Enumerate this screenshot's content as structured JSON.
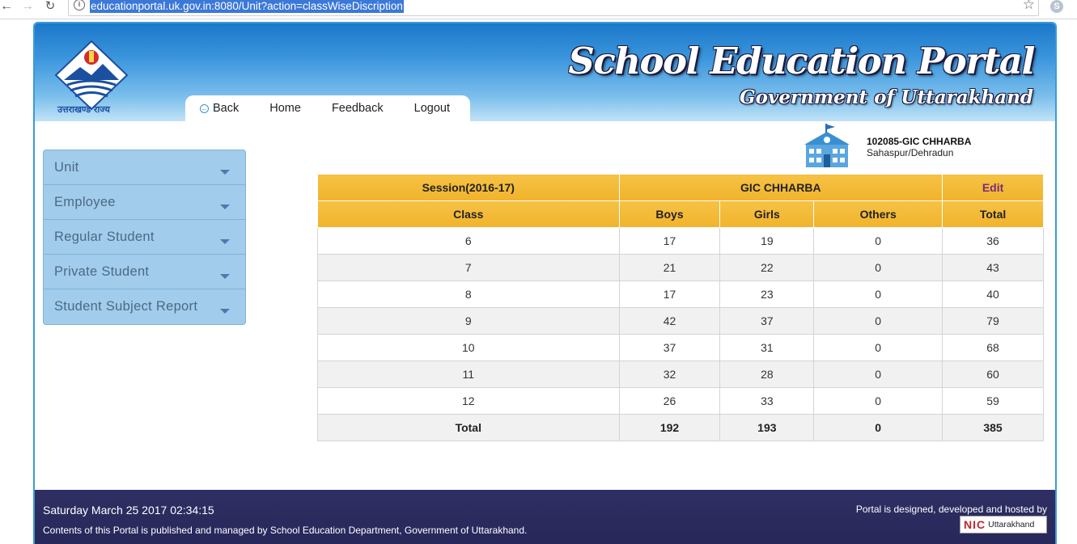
{
  "browser": {
    "url": "educationportal.uk.gov.in:8080/Unit?action=classWiseDiscription"
  },
  "header": {
    "logo_caption": "उत्तराखण्ड राज्य",
    "title": "School Education Portal",
    "subtitle": "Government of Uttarakhand"
  },
  "menu": {
    "back": "Back",
    "home": "Home",
    "feedback": "Feedback",
    "logout": "Logout"
  },
  "school": {
    "code": "102085-GIC CHHARBA",
    "location": "Sahaspur/Dehradun"
  },
  "sidebar": {
    "items": [
      {
        "label": "Unit"
      },
      {
        "label": "Employee"
      },
      {
        "label": "Regular Student"
      },
      {
        "label": "Private Student"
      },
      {
        "label": "Student Subject Report"
      }
    ]
  },
  "table": {
    "session": "Session(2016-17)",
    "school_name": "GIC CHHARBA",
    "edit": "Edit",
    "columns": [
      "Class",
      "Boys",
      "Girls",
      "Others",
      "Total"
    ],
    "rows": [
      [
        "6",
        "17",
        "19",
        "0",
        "36"
      ],
      [
        "7",
        "21",
        "22",
        "0",
        "43"
      ],
      [
        "8",
        "17",
        "23",
        "0",
        "40"
      ],
      [
        "9",
        "42",
        "37",
        "0",
        "79"
      ],
      [
        "10",
        "37",
        "31",
        "0",
        "68"
      ],
      [
        "11",
        "32",
        "28",
        "0",
        "60"
      ],
      [
        "12",
        "26",
        "33",
        "0",
        "59"
      ]
    ],
    "total": [
      "Total",
      "192",
      "193",
      "0",
      "385"
    ]
  },
  "footer": {
    "datetime": "Saturday March 25 2017 02:34:15",
    "note": "Contents of this Portal is published and managed by School Education Department, Government of Uttarakhand.",
    "hosted": "Portal is designed, developed and hosted by",
    "nic_mark": "NIC",
    "nic_text": "Uttarakhand"
  },
  "colors": {
    "header_blue": "#3b95dc",
    "table_header": "#f1b32c",
    "sidebar": "#a2cceb",
    "footer": "#2f2f63",
    "edit_link": "#7b2a7a"
  }
}
